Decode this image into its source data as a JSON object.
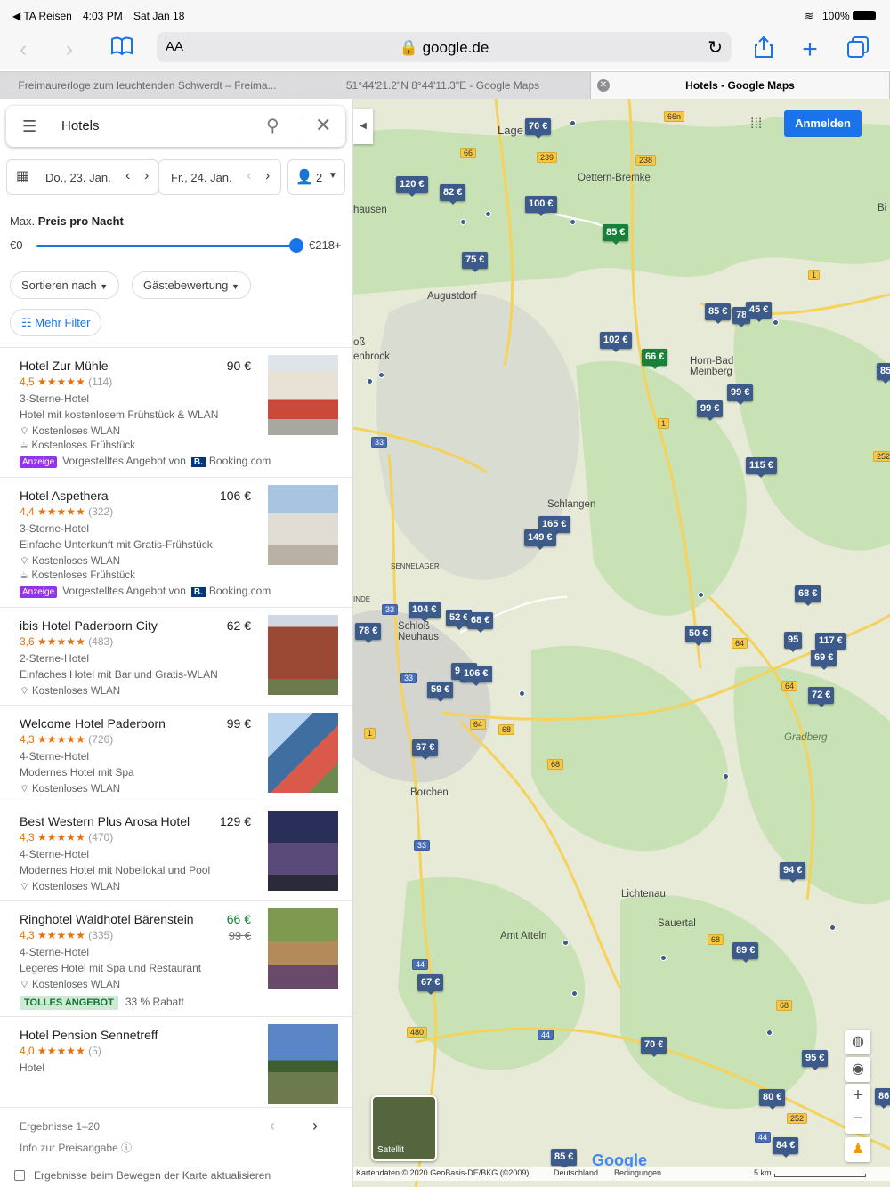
{
  "status": {
    "carrier": "◀ TA Reisen",
    "time": "4:03 PM",
    "date": "Sat Jan 18",
    "battery": "100%"
  },
  "toolbar": {
    "text_size": "AA",
    "url": "🔒 google.de"
  },
  "tabs": [
    {
      "label": "Freimaurerloge zum leuchtenden Schwerdt – Freima..."
    },
    {
      "label": "51°44'21.2\"N 8°44'11.3\"E - Google Maps"
    },
    {
      "label": "Hotels - Google Maps"
    }
  ],
  "search": {
    "query": "Hotels"
  },
  "dates": {
    "checkin": "Do., 23. Jan.",
    "checkout": "Fr., 24. Jan.",
    "guests": "2"
  },
  "price_filter": {
    "label_prefix": "Max.",
    "label_bold": "Preis pro Nacht",
    "min": "€0",
    "max": "€218+",
    "level": 1.0
  },
  "chips": {
    "sort": "Sortieren nach",
    "rating": "Gästebewertung",
    "more": "Mehr Filter"
  },
  "hotels": [
    {
      "name": "Hotel Zur Mühle",
      "price": "90 €",
      "score": "4,5",
      "stars": "★★★★★",
      "count": "(114)",
      "class": "3-Sterne-Hotel",
      "desc": "Hotel mit kostenlosem Frühstück & WLAN",
      "f1": "Kostenloses WLAN",
      "f2": "Kostenloses Frühstück",
      "ad_badge": "Anzeige",
      "ad_text": "Vorgestelltes Angebot von",
      "ad_logo": "B.",
      "ad_source": "Booking.com"
    },
    {
      "name": "Hotel Aspethera",
      "price": "106 €",
      "score": "4,4",
      "stars": "★★★★★",
      "count": "(322)",
      "class": "3-Sterne-Hotel",
      "desc": "Einfache Unterkunft mit Gratis-Frühstück",
      "f1": "Kostenloses WLAN",
      "f2": "Kostenloses Frühstück",
      "ad_badge": "Anzeige",
      "ad_text": "Vorgestelltes Angebot von",
      "ad_logo": "B.",
      "ad_source": "Booking.com"
    },
    {
      "name": "ibis Hotel Paderborn City",
      "price": "62 €",
      "score": "3,6",
      "stars": "★★★★★",
      "count": "(483)",
      "class": "2-Sterne-Hotel",
      "desc": "Einfaches Hotel mit Bar und Gratis-WLAN",
      "f1": "Kostenloses WLAN"
    },
    {
      "name": "Welcome Hotel Paderborn",
      "price": "99 €",
      "score": "4,3",
      "stars": "★★★★★",
      "count": "(726)",
      "class": "4-Sterne-Hotel",
      "desc": "Modernes Hotel mit Spa",
      "f1": "Kostenloses WLAN"
    },
    {
      "name": "Best Western Plus Arosa Hotel",
      "price": "129 €",
      "score": "4,3",
      "stars": "★★★★★",
      "count": "(470)",
      "class": "4-Sterne-Hotel",
      "desc": "Modernes Hotel mit Nobellokal und Pool",
      "f1": "Kostenloses WLAN"
    },
    {
      "name": "Ringhotel Waldhotel Bärenstein",
      "price": "66 €",
      "old_price": "99 €",
      "score": "4,3",
      "stars": "★★★★★",
      "count": "(335)",
      "class": "4-Sterne-Hotel",
      "desc": "Legeres Hotel mit Spa und Restaurant",
      "f1": "Kostenloses WLAN",
      "deal_badge": "TOLLES ANGEBOT",
      "deal_text": "33 % Rabatt"
    },
    {
      "name": "Hotel Pension Sennetreff",
      "score": "4,0",
      "stars": "★★★★★",
      "count": "(5)",
      "class": "Hotel"
    }
  ],
  "pager": {
    "results": "Ergebnisse 1–20",
    "info": "Info zur Preisangabe ⓘ",
    "update": "Ergebnisse beim Bewegen der Karte aktualisieren"
  },
  "map": {
    "signin": "Anmelden",
    "satellite": "Satellit",
    "attribution": "Kartendaten © 2020 GeoBasis-DE/BKG (©2009)",
    "country": "Deutschland",
    "terms": "Bedingungen",
    "scale": "5 km",
    "logo": "Google",
    "towns": [
      "Lage",
      "Oettern-Bremke",
      "Augustdorf",
      "Horn-Bad Meinberg",
      "Schlangen",
      "SENNELAGER",
      "Schloß Neuhaus",
      "Borchen",
      "Gradberg",
      "Lichtenau",
      "Sauertal",
      "Amt Atteln",
      "hausen",
      "oß",
      "enbrock",
      "INDE",
      "Bi"
    ],
    "pins": [
      "70 €",
      "120 €",
      "82 €",
      "100 €",
      "85 €",
      "75 €",
      "85 €",
      "78",
      "45 €",
      "102 €",
      "66 €",
      "99 €",
      "99 €",
      "115 €",
      "165 €",
      "149 €",
      "104 €",
      "52 €",
      "68 €",
      "78 €",
      "50 €",
      "68 €",
      "95",
      "117 €",
      "69 €",
      "72 €",
      "98 €",
      "106 €",
      "59 €",
      "67 €",
      "94 €",
      "89 €",
      "67 €",
      "70 €",
      "95 €",
      "80 €",
      "84 €",
      "85 €",
      "85",
      "86"
    ],
    "roads": [
      "66n",
      "66",
      "239",
      "238",
      "1",
      "252",
      "1",
      "33",
      "33",
      "64",
      "68",
      "68",
      "64",
      "64",
      "33",
      "44",
      "480",
      "44",
      "68",
      "68",
      "252",
      "44",
      "1",
      "33"
    ]
  }
}
